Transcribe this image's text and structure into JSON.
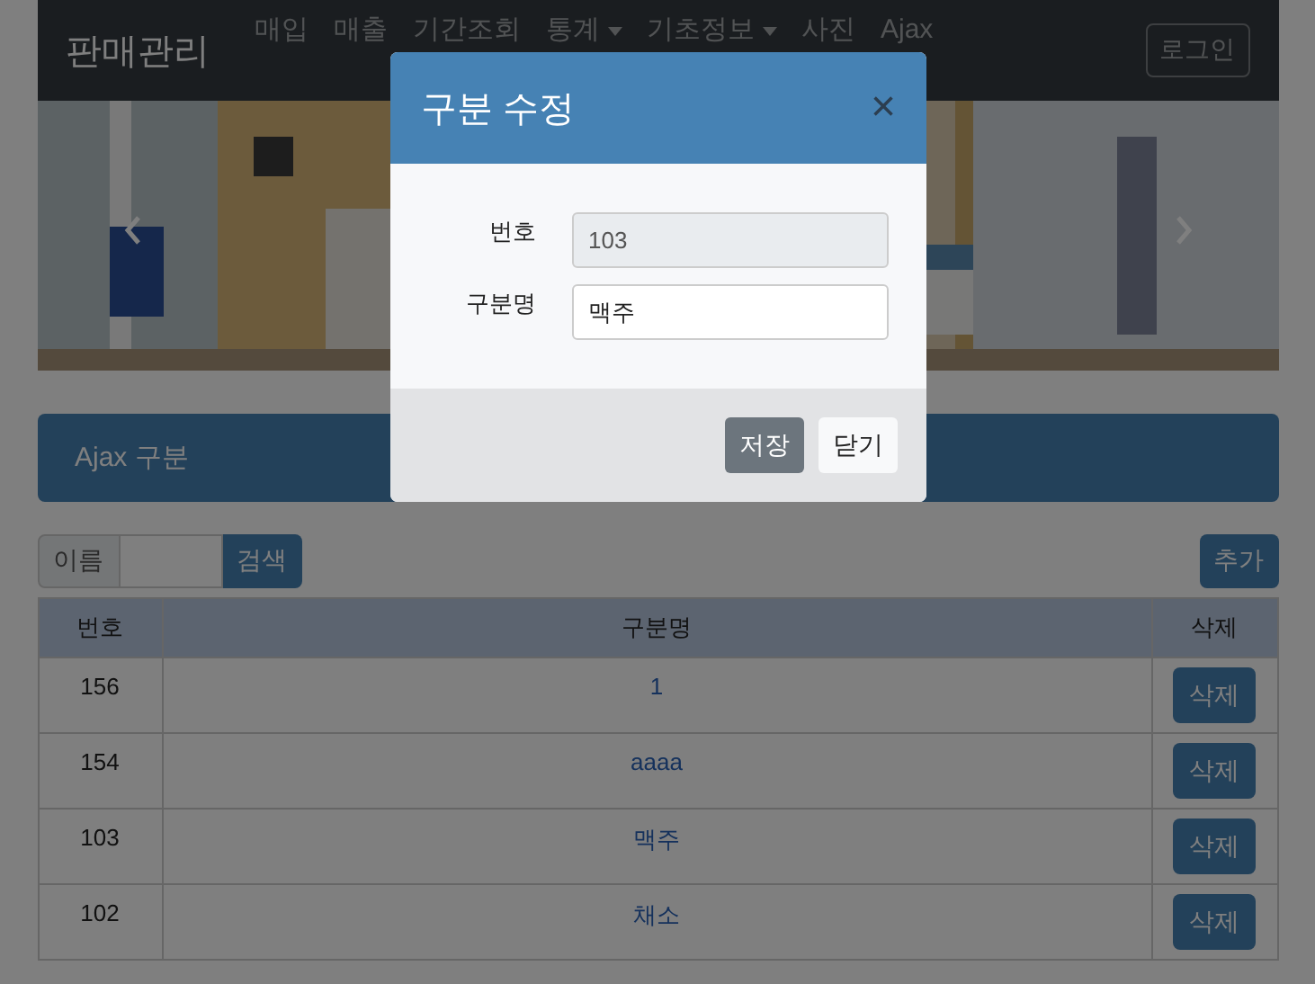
{
  "navbar": {
    "brand": "판매관리",
    "items": [
      {
        "label": "매입",
        "dropdown": false
      },
      {
        "label": "매출",
        "dropdown": false
      },
      {
        "label": "기간조회",
        "dropdown": false
      },
      {
        "label": "통계",
        "dropdown": true
      },
      {
        "label": "기초정보",
        "dropdown": true
      },
      {
        "label": "사진",
        "dropdown": false
      },
      {
        "label": "Ajax",
        "dropdown": false
      }
    ],
    "login": "로그인"
  },
  "panel": {
    "title": "Ajax 구분"
  },
  "search": {
    "label": "이름",
    "button": "검색"
  },
  "add_button": "추가",
  "table": {
    "columns": [
      "번호",
      "구분명",
      "삭제"
    ],
    "rows": [
      {
        "no": "156",
        "name": "1",
        "action": "삭제"
      },
      {
        "no": "154",
        "name": "aaaa",
        "action": "삭제"
      },
      {
        "no": "103",
        "name": "맥주",
        "action": "삭제"
      },
      {
        "no": "102",
        "name": "채소",
        "action": "삭제"
      }
    ]
  },
  "modal": {
    "title": "구분 수정",
    "close": "×",
    "fields": [
      {
        "label": "번호",
        "value": "103",
        "disabled": true
      },
      {
        "label": "구분명",
        "value": "맥주",
        "disabled": false
      }
    ],
    "buttons": [
      {
        "label": "저장",
        "kind": "secondary"
      },
      {
        "label": "닫기",
        "kind": "light"
      }
    ]
  }
}
